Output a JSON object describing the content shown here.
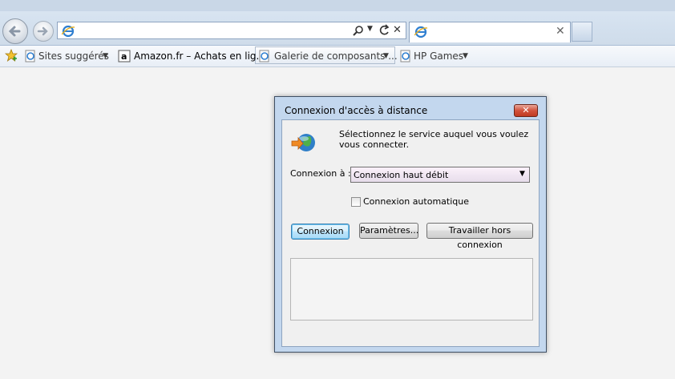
{
  "browser": {
    "address_value": "",
    "tab_title": "",
    "favorites": [
      {
        "label": "Sites suggérés",
        "icon": "ie-page-icon",
        "has_dropdown": true
      },
      {
        "label": "Amazon.fr – Achats en lig...",
        "icon": "amazon-icon",
        "has_dropdown": false
      },
      {
        "label": "Galerie de composants ...",
        "icon": "ie-page-icon",
        "has_dropdown": true
      },
      {
        "label": "HP Games",
        "icon": "ie-page-icon",
        "has_dropdown": true
      }
    ]
  },
  "dialog": {
    "title": "Connexion d'accès à distance",
    "close_label": "✕",
    "intro": "Sélectionnez le service auquel vous voulez vous connecter.",
    "connect_to_label": "Connexion à :",
    "connect_to_value": "Connexion haut débit",
    "auto_connect_label": "Connexion automatique",
    "auto_connect_checked": false,
    "buttons": {
      "connect": "Connexion",
      "settings": "Paramètres...",
      "offline": "Travailler hors connexion"
    }
  },
  "colors": {
    "dialog_frame": "#c3d7ee",
    "close_button": "#d2533d",
    "default_button": "#bee6fd"
  }
}
